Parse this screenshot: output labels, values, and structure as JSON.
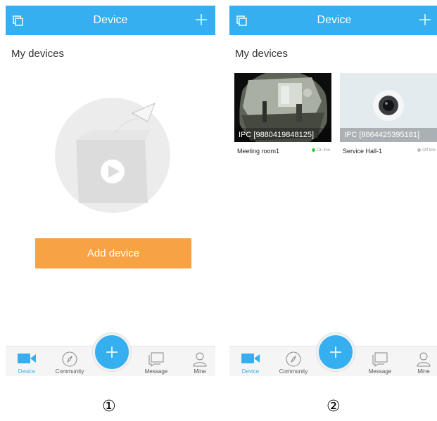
{
  "colors": {
    "accent": "#35aff0",
    "add_button": "#f7a345",
    "online": "#2ecc40",
    "offline": "#bbbbbb"
  },
  "screens": [
    {
      "header": {
        "title": "Device",
        "left_icon": "multi-window-icon",
        "right_icon": "plus-icon"
      },
      "section_title": "My devices",
      "empty_state": {
        "illustration": "empty-box-with-paper-plane-icon",
        "add_button_label": "Add device"
      },
      "nav": {
        "device": "Device",
        "community": "Community",
        "message": "Message",
        "mine": "Mine"
      },
      "caption": "①"
    },
    {
      "header": {
        "title": "Device",
        "left_icon": "multi-window-icon",
        "right_icon": "plus-icon"
      },
      "section_title": "My devices",
      "devices": [
        {
          "ipc": "IPC [9880419848125]",
          "name": "Meeting room1",
          "status": "On line",
          "online": true
        },
        {
          "ipc": "IPC [9864425395181]",
          "name": "Service Hall-1",
          "status": "Off line",
          "online": false
        }
      ],
      "nav": {
        "device": "Device",
        "community": "Community",
        "message": "Message",
        "mine": "Mine"
      },
      "caption": "②"
    }
  ]
}
